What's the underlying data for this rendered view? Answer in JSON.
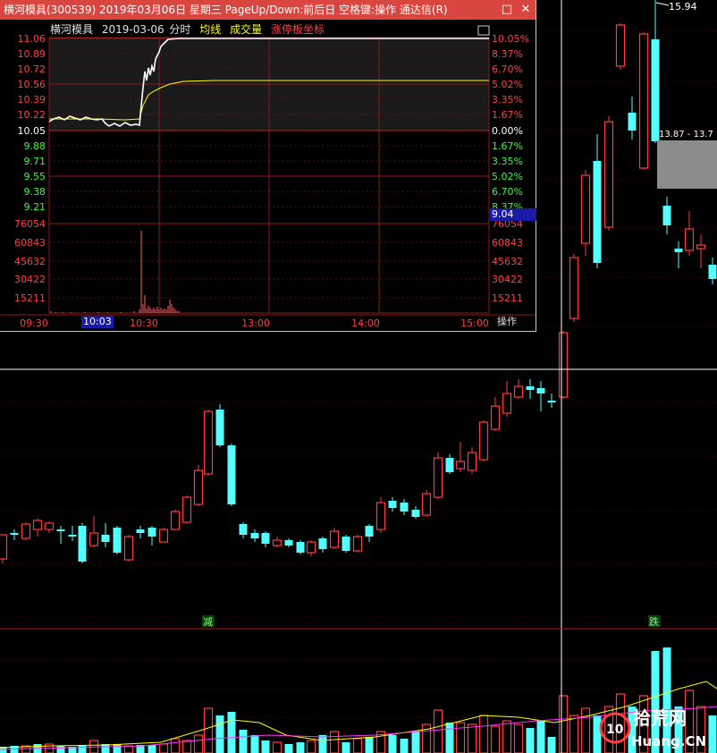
{
  "window": {
    "title": "横河模具(300539) 2019年03月06日 星期三 PageUp/Down:前后日 空格键:操作 通达信(R)",
    "restore_icon": "restore-icon",
    "close_icon": "close-icon"
  },
  "intraday": {
    "stock_name": "横河模具",
    "date": "2019-03-06",
    "mode": "分时",
    "legend_avg": "均线",
    "legend_volume": "成交量",
    "legend_limit": "涨停板坐标",
    "price_labels": [
      "11.06",
      "10.89",
      "10.72",
      "10.56",
      "10.39",
      "10.22",
      "10.05",
      "9.88",
      "9.71",
      "9.55",
      "9.38",
      "9.21"
    ],
    "pct_labels": [
      "10.05%",
      "8.37%",
      "6.70%",
      "5.02%",
      "3.35%",
      "1.67%",
      "0.00%",
      "1.67%",
      "3.35%",
      "5.02%",
      "6.70%",
      "8.37%"
    ],
    "current_price_tag": "9.04",
    "volume_labels": [
      "76054",
      "60843",
      "45632",
      "30422",
      "15211"
    ],
    "time_labels": [
      "09:30",
      "10:03",
      "10:30",
      "13:00",
      "14:00",
      "15:00"
    ],
    "action_label": "操作",
    "colors": {
      "price_line": "#ffffff",
      "avg_line": "#ffff00",
      "up": "#ff3b3b",
      "down": "#00ff00",
      "grid": "#8b1a1a"
    }
  },
  "kline": {
    "high_label": "15.94",
    "range_label": "13.87 - 13.7",
    "signal_reduce": "减",
    "signal_fall": "跌",
    "colors": {
      "up": "#ff3b3b",
      "down": "#54ffff",
      "grid": "#7a0000",
      "ma_yellow": "#ffff00",
      "ma_magenta": "#ff33ff"
    }
  },
  "watermark": {
    "brand": "拾荒网",
    "domain": "Huang.CN",
    "logo_text": "10"
  }
}
